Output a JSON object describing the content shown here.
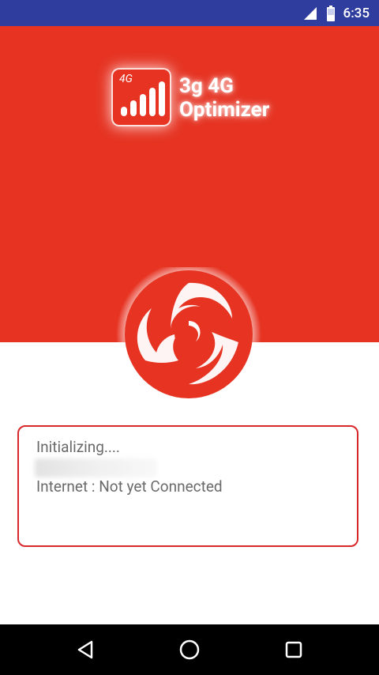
{
  "status_bar": {
    "time": "6:35"
  },
  "header": {
    "app_icon_label": "4G",
    "title_line1": "3g 4G",
    "title_line2": "Optimizer"
  },
  "status_card": {
    "line1": "Initializing....",
    "line3": "Internet : Not yet Connected"
  },
  "colors": {
    "primary": "#e63322",
    "status_bar": "#2f3e9e",
    "card_border": "#d8282a",
    "text": "#6a6a6a"
  },
  "icons": {
    "signal": "signal-icon",
    "battery": "battery-icon",
    "spinner": "swirl-logo-icon",
    "back": "back-icon",
    "home": "home-icon",
    "recents": "recents-icon"
  }
}
